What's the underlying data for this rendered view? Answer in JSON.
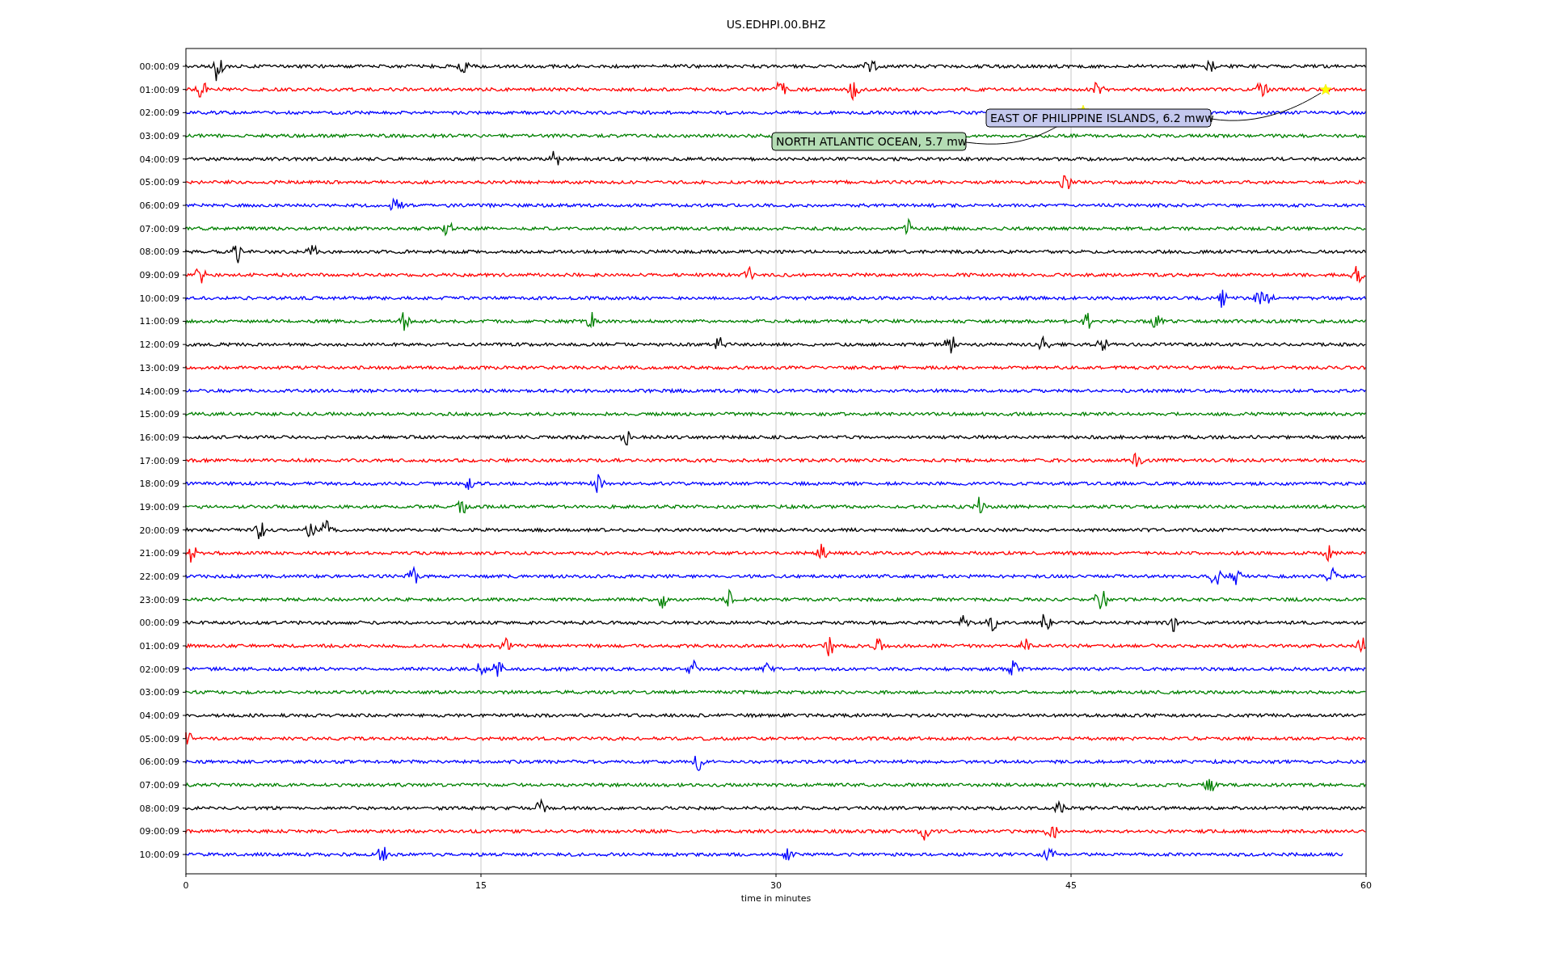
{
  "title": "US.EDHPI.00.BHZ",
  "x_axis": {
    "label": "time in minutes",
    "ticks": [
      "0",
      "15",
      "30",
      "45",
      "60"
    ]
  },
  "traces": [
    {
      "label": "00:00:09",
      "color": "#000000"
    },
    {
      "label": "01:00:09",
      "color": "#ff0000"
    },
    {
      "label": "02:00:09",
      "color": "#0000ff"
    },
    {
      "label": "03:00:09",
      "color": "#008000"
    },
    {
      "label": "04:00:09",
      "color": "#000000"
    },
    {
      "label": "05:00:09",
      "color": "#ff0000"
    },
    {
      "label": "06:00:09",
      "color": "#0000ff"
    },
    {
      "label": "07:00:09",
      "color": "#008000"
    },
    {
      "label": "08:00:09",
      "color": "#000000"
    },
    {
      "label": "09:00:09",
      "color": "#ff0000"
    },
    {
      "label": "10:00:09",
      "color": "#0000ff"
    },
    {
      "label": "11:00:09",
      "color": "#008000"
    },
    {
      "label": "12:00:09",
      "color": "#000000"
    },
    {
      "label": "13:00:09",
      "color": "#ff0000"
    },
    {
      "label": "14:00:09",
      "color": "#0000ff"
    },
    {
      "label": "15:00:09",
      "color": "#008000"
    },
    {
      "label": "16:00:09",
      "color": "#000000"
    },
    {
      "label": "17:00:09",
      "color": "#ff0000"
    },
    {
      "label": "18:00:09",
      "color": "#0000ff"
    },
    {
      "label": "19:00:09",
      "color": "#008000"
    },
    {
      "label": "20:00:09",
      "color": "#000000"
    },
    {
      "label": "21:00:09",
      "color": "#ff0000"
    },
    {
      "label": "22:00:09",
      "color": "#0000ff"
    },
    {
      "label": "23:00:09",
      "color": "#008000"
    },
    {
      "label": "00:00:09",
      "color": "#000000"
    },
    {
      "label": "01:00:09",
      "color": "#ff0000"
    },
    {
      "label": "02:00:09",
      "color": "#0000ff"
    },
    {
      "label": "03:00:09",
      "color": "#008000"
    },
    {
      "label": "04:00:09",
      "color": "#000000"
    },
    {
      "label": "05:00:09",
      "color": "#ff0000"
    },
    {
      "label": "06:00:09",
      "color": "#0000ff"
    },
    {
      "label": "07:00:09",
      "color": "#008000"
    },
    {
      "label": "08:00:09",
      "color": "#000000"
    },
    {
      "label": "09:00:09",
      "color": "#ff0000"
    },
    {
      "label": "10:00:09",
      "color": "#0000ff"
    }
  ],
  "annotations": [
    {
      "text": "EAST OF PHILIPPINE ISLANDS, 6.2 mww",
      "color": "#c4c8ee"
    },
    {
      "text": "NORTH ATLANTIC OCEAN, 5.7 mw",
      "color": "#b4dcb4"
    }
  ]
}
